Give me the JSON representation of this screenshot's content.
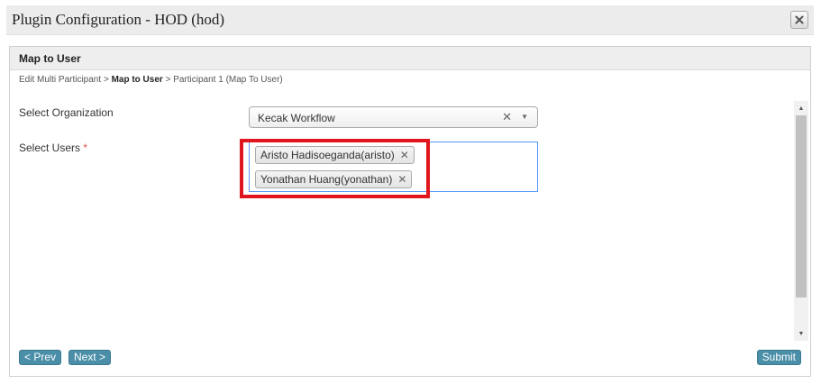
{
  "dialog": {
    "title": "Plugin Configuration - HOD (hod)"
  },
  "panel": {
    "title": "Map to User"
  },
  "breadcrumb": {
    "items": [
      "Edit Multi Participant",
      "Map to User",
      "Participant 1 (Map To User)"
    ],
    "separator": ">"
  },
  "form": {
    "organization": {
      "label": "Select Organization",
      "value": "Kecak Workflow",
      "clear": "✕",
      "arrow": "▼"
    },
    "users": {
      "label": "Select Users",
      "required_mark": "*",
      "selected": [
        "Aristo Hadisoeganda(aristo)",
        "Yonathan Huang(yonathan)"
      ],
      "remove": "✕"
    }
  },
  "footer": {
    "prev_label": "< Prev",
    "next_label": "Next >",
    "submit_label": "Submit"
  },
  "colors": {
    "button": "#4a8ea8",
    "highlight": "#e0161f",
    "focus_border": "#5897fb"
  },
  "icons": {
    "close": "close-icon",
    "clear": "clear-icon",
    "dropdown": "chevron-down-icon",
    "scroll_up": "scroll-up-icon",
    "scroll_down": "scroll-down-icon"
  }
}
